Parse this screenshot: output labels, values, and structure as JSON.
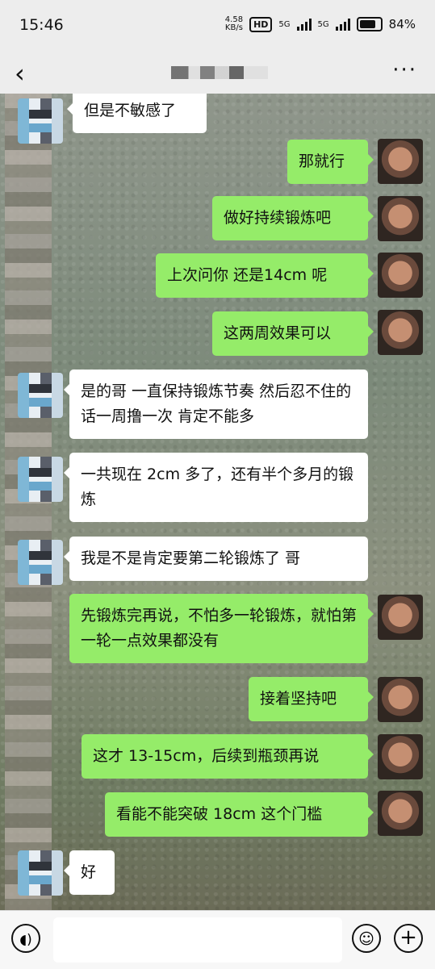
{
  "status_bar": {
    "time": "15:46",
    "net_speed": "4.58",
    "net_unit": "KB/s",
    "hd_label": "HD",
    "signal1_label": "5G",
    "signal2_label": "5G",
    "battery_level": "84%"
  },
  "header": {
    "back_icon": "‹",
    "more_icon": "···"
  },
  "messages": [
    {
      "side": "in",
      "text": "但是不敏感了"
    },
    {
      "side": "out",
      "text": "那就行"
    },
    {
      "side": "out",
      "text": "做好持续锻炼吧"
    },
    {
      "side": "out",
      "text": "上次问你 还是14cm 呢"
    },
    {
      "side": "out",
      "text": "这两周效果可以"
    },
    {
      "side": "in",
      "text": "是的哥 一直保持锻炼节奏 然后忍不住的话一周撸一次 肯定不能多"
    },
    {
      "side": "in",
      "text": "一共现在 2cm 多了，还有半个多月的锻炼"
    },
    {
      "side": "in",
      "text": "我是不是肯定要第二轮锻炼了 哥"
    },
    {
      "side": "out",
      "text": "先锻炼完再说，不怕多一轮锻炼，就怕第一轮一点效果都没有"
    },
    {
      "side": "out",
      "text": "接着坚持吧"
    },
    {
      "side": "out",
      "text": "这才 13-15cm，后续到瓶颈再说"
    },
    {
      "side": "out",
      "text": "看能不能突破 18cm 这个门槛"
    },
    {
      "side": "in",
      "text": "好"
    }
  ],
  "input_bar": {
    "voice_icon": "◖)",
    "emoji_icon": "☺",
    "plus_icon": "+",
    "placeholder": ""
  }
}
